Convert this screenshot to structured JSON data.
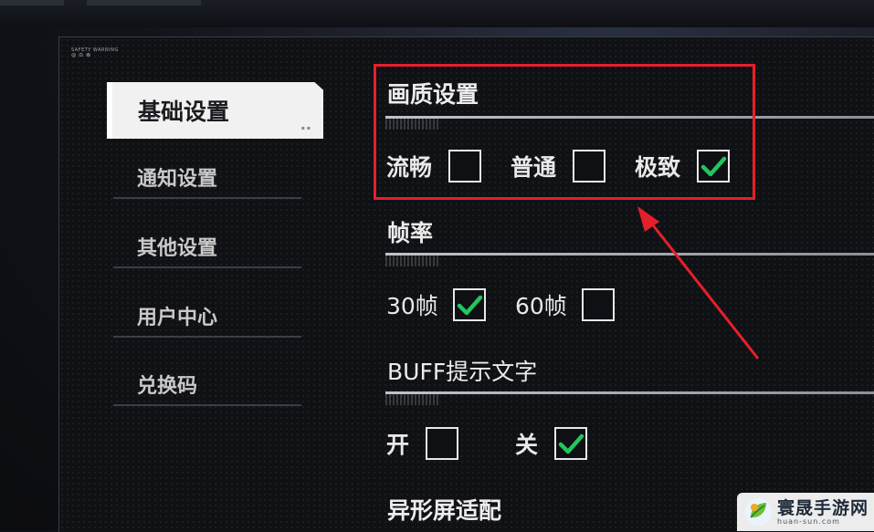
{
  "brand": {
    "text": "SAFETY WARNING",
    "sub": "◎ ⊙ ⊛"
  },
  "sidebar": {
    "active": {
      "label": "基础设置",
      "tag": "▪ ▪"
    },
    "items": [
      {
        "label": "通知设置"
      },
      {
        "label": "其他设置"
      },
      {
        "label": "用户中心"
      },
      {
        "label": "兑换码"
      }
    ]
  },
  "sections": {
    "quality": {
      "title": "画质设置",
      "options": [
        {
          "label": "流畅",
          "checked": false
        },
        {
          "label": "普通",
          "checked": false
        },
        {
          "label": "极致",
          "checked": true
        }
      ]
    },
    "framerate": {
      "title": "帧率",
      "options": [
        {
          "label": "30帧",
          "checked": true
        },
        {
          "label": "60帧",
          "checked": false
        }
      ]
    },
    "buff": {
      "title": "BUFF提示文字",
      "options": [
        {
          "label": "开",
          "checked": false
        },
        {
          "label": "关",
          "checked": true
        }
      ]
    },
    "notch": {
      "title": "异形屏适配"
    }
  },
  "colors": {
    "highlight": "#e4202a",
    "check": "#22c55e"
  },
  "watermark": {
    "name": "寰晟手游网",
    "url": "huan-sun.com"
  }
}
